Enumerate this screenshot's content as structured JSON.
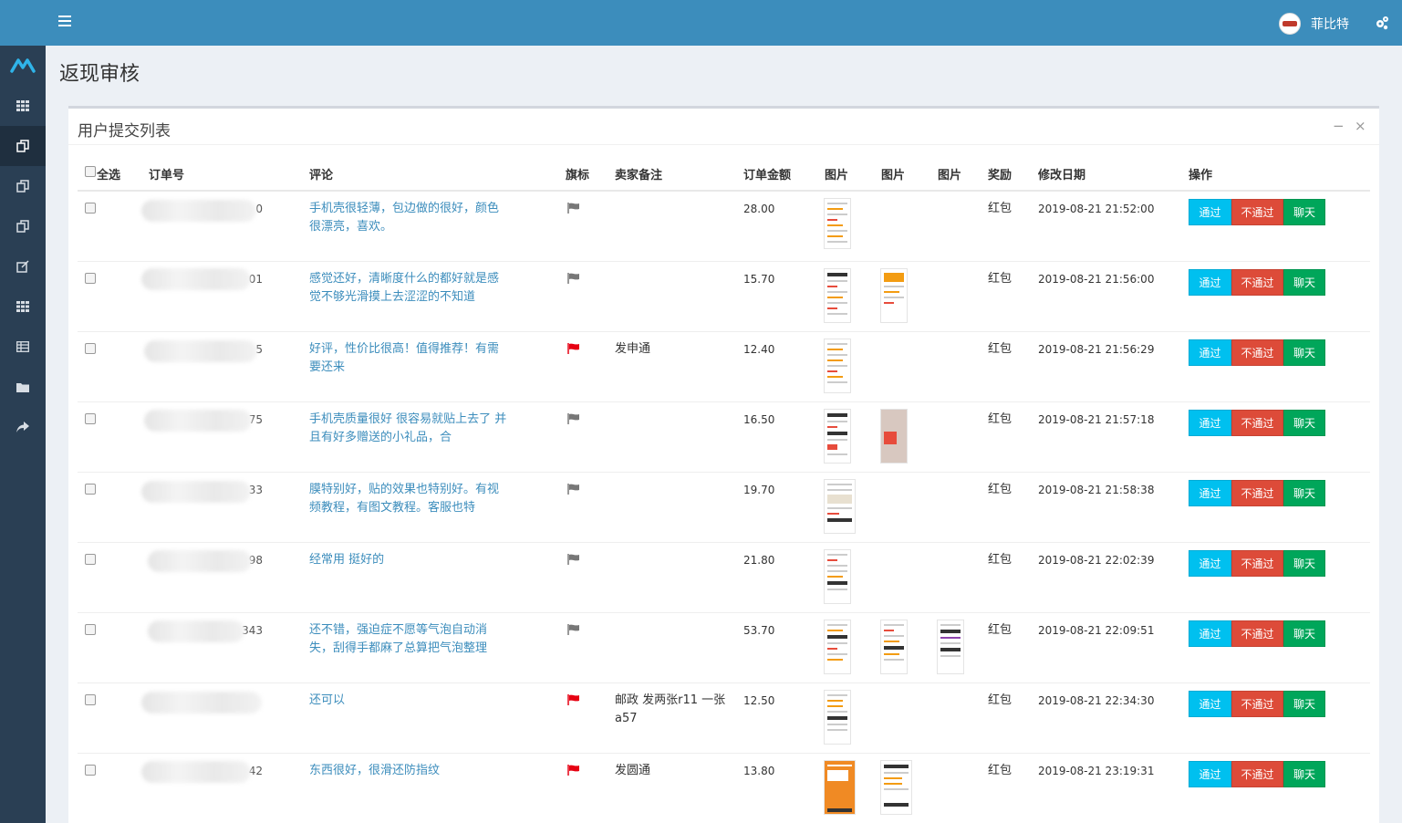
{
  "header": {
    "user_name": "菲比特"
  },
  "page": {
    "title": "返现审核"
  },
  "panel": {
    "title": "用户提交列表",
    "minimize": "−",
    "close": "×"
  },
  "table": {
    "columns": {
      "select_all": "全选",
      "order_no": "订单号",
      "comment": "评论",
      "flag": "旗标",
      "seller_note": "卖家备注",
      "amount": "订单金额",
      "image1": "图片",
      "image2": "图片",
      "image3": "图片",
      "reward": "奖励",
      "modified": "修改日期",
      "actions": "操作"
    },
    "actions": {
      "pass": "通过",
      "fail": "不通过",
      "chat": "聊天"
    },
    "rows": [
      {
        "order_suffix": "0",
        "comment": "手机壳很轻薄，包边做的很好，颜色很漂亮，喜欢。",
        "flag": "gray",
        "note": "",
        "amount": "28.00",
        "reward": "红包",
        "date": "2019-08-21 21:52:00"
      },
      {
        "order_suffix": "01",
        "comment": "感觉还好，清晰度什么的都好就是感觉不够光滑摸上去涩涩的不知道",
        "flag": "gray",
        "note": "",
        "amount": "15.70",
        "reward": "红包",
        "date": "2019-08-21 21:56:00"
      },
      {
        "order_suffix": "5",
        "comment": "好评，性价比很高！值得推荐！有需要还来",
        "flag": "red",
        "note": "发申通",
        "amount": "12.40",
        "reward": "红包",
        "date": "2019-08-21 21:56:29"
      },
      {
        "order_suffix": "75",
        "comment": "手机壳质量很好 很容易就贴上去了 并且有好多赠送的小礼品，合",
        "flag": "gray",
        "note": "",
        "amount": "16.50",
        "reward": "红包",
        "date": "2019-08-21 21:57:18"
      },
      {
        "order_suffix": "33",
        "comment": "膜特别好，贴的效果也特别好。有视频教程，有图文教程。客服也特",
        "flag": "gray",
        "note": "",
        "amount": "19.70",
        "reward": "红包",
        "date": "2019-08-21 21:58:38"
      },
      {
        "order_suffix": "98",
        "comment": "经常用 挺好的",
        "flag": "gray",
        "note": "",
        "amount": "21.80",
        "reward": "红包",
        "date": "2019-08-21 22:02:39"
      },
      {
        "order_suffix": "343",
        "comment": "还不错，强迫症不愿等气泡自动消失，刮得手都麻了总算把气泡整理",
        "flag": "gray",
        "note": "",
        "amount": "53.70",
        "reward": "红包",
        "date": "2019-08-21 22:09:51"
      },
      {
        "order_suffix": "",
        "comment": "还可以",
        "flag": "red",
        "note": "邮政 发两张r11 一张a57",
        "amount": "12.50",
        "reward": "红包",
        "date": "2019-08-21 22:34:30"
      },
      {
        "order_suffix": "42",
        "comment": "东西很好，很滑还防指纹",
        "flag": "red",
        "note": "发圆通",
        "amount": "13.80",
        "reward": "红包",
        "date": "2019-08-21 23:19:31"
      }
    ]
  },
  "colors": {
    "primary": "#3c8dbc",
    "sidebar": "#2a3f54",
    "pass": "#00c0ef",
    "fail": "#dd4b39",
    "chat": "#00a65a",
    "flag_red": "#e60012",
    "flag_gray": "#777777"
  }
}
